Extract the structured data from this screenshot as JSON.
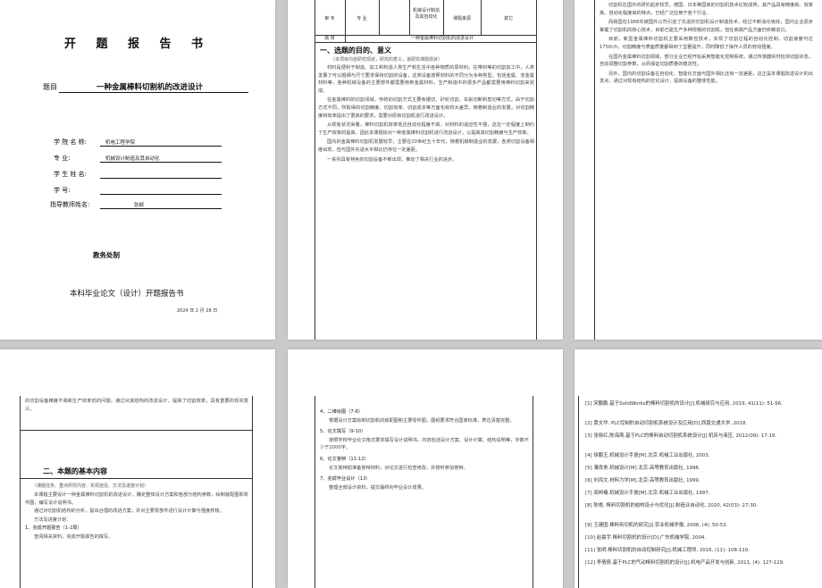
{
  "cover": {
    "title": "开 题 报 告 书",
    "topic_label": "题目",
    "topic_value": "一种金属棒料切割机的改进设计",
    "fields": [
      {
        "label": "学 院 名 称:",
        "value": "机电工程学院"
      },
      {
        "label": "专       业:",
        "value": "机械设计制造及其自动化"
      },
      {
        "label": "学 生 姓 名:",
        "value": ""
      },
      {
        "label": "学       号:",
        "value": ""
      },
      {
        "label": "指导教师姓名:",
        "value": "张颖"
      }
    ],
    "office": "教务处制",
    "report_name": "本科毕业论文（设计）开题报告书",
    "date": "2024 年 2 月 28 日"
  },
  "page2": {
    "table_row": [
      "审 专",
      "专 业",
      "机械设计制造及其自动化",
      "课题来源",
      "其它"
    ],
    "topic_row_label": "题  目",
    "topic_row_value": "一种金属棒料切割机的改进设计",
    "section1": "一、选题的目的、意义",
    "section1_note": "（本项目内容研究现状，研究的意义，该研究课题现状）",
    "paragraphs": [
      "材料是便利于制造、加工和构造人类生产和生活中各种物质的原材料。在带材等的切割加工中，人类发展了可以粗细与尺寸要求保持切割的设备，这类设备按照材料的不同分为多种类型，包括金属、非金属材料等，各种机械设备的主要部件都需要用到金属材料，生产制造中的很多产品都需要用棒料切割来完成。",
      "在金属棒料的切割领域，传统的切割方式主要有锯切、砂轮切割、车削切断和剪切等方式，由于切割方式不同，所取得的切割精度、切割效率、切割成本等方面也有较大差异。随着制造业的发展，对切割精度和效率提出了更高的要求，需要对原有切割机进行改进设计。",
      "从现有状况来看，棒料切割机效率低且自动化程度不高，对材料的适应性不强，这在一定程度上制约了生产效率的提高。因此本课题拟对一种金属棒料切割机进行改进设计，以提高其切割精度与生产效率。",
      "国内的金属棒料切割机发展较早，主要在20世纪五十年代，随着机械制造业的发展，各类切割设备相继出现，但与国外先进水平相比仍存在一定差距。",
      "一系列具有特色的切割设备不断出现，推动了相关行业的进步。"
    ]
  },
  "page3": {
    "paragraphs": [
      "切割机在国外的研究起步较早，德国、日本等国家的切割机技术比较成熟，其产品具有精度高、效率高、自动化程度高的特点，已经广泛应用于各个行业。",
      "而我国在1988年被国外公司引进了先进的切割机设计制造技术，经过不断消化吸收，国内企业逐步掌握了切割机的核心技术，目前已能生产多种规格的切割机，但在高端产品方面仍依赖进口。",
      "目前，新型金属棒料切割机主要采用数控技术，实现了切割过程的自动化控制，切割速度可达1750r/h，切割精度与表面质量都得到了显著提升，同时降低了操作人员的劳动强度。",
      "在国内金属棒料切割领域，部分企业已经开始采用智能化控制系统，通过传感器实时检测切割状态，自动调整切割参数，从而保证切割质量的稳定性。",
      "另外，国内的切割设备在自动化、智能化方面与国外相比还有一定差距，这正是本课题改进设计的出发点，通过对现有结构的优化设计，提高设备的整体性能。"
    ]
  },
  "page4": {
    "intro": "的切割设备精度不高和生产效率低的问题，通过对其结构的改进设计，提高了切割效率，具有重要的现实意义。",
    "section2": "二、本题的基本内容",
    "section2_note": "（课题任务、重点研究内容、实现途径、方法及进度计划）",
    "paragraphs": [
      "本课题主要设计一种金属棒料切割机的改进设计，确定整体设计方案和各部分结构参数，绘制装配图和零件图，编写设计说明书。",
      "通过对切割机结构的分析，提出合理的改进方案，并对主要零部件进行设计计算与强度校核。",
      "方法及进度计划："
    ],
    "step1": "1、完成开题报告（1-2周）",
    "step1_text": "查阅相关资料，完成开题报告的撰写。"
  },
  "page5": {
    "steps": [
      {
        "title": "4、二维绘图（7-8）",
        "text": "根据设计方案绘制切割机的装配图和主要零件图，图纸要求符合国家标准，表达清楚完整。"
      },
      {
        "title": "5、论文撰写（9-10）",
        "text": "按照学校毕业论文格式要求撰写设计说明书，内容包括设计方案、设计计算、结构说明等，字数不少于2000字。"
      },
      {
        "title": "6、论文答辩（11-12）",
        "text": "论文答辩前准备答辩材料，对论文进行检查修改，并按时参加答辩。"
      },
      {
        "title": "7、完成毕业设计（13）",
        "text": "整理全部设计资料，提交最终的毕业设计成果。"
      }
    ]
  },
  "page6": {
    "references": [
      "[1] 宋鹏鹏.基于SolidWorks的棒料切割机的设计[J].机械研究与应用, 2019, 41(11): 51-56.",
      "[2] 黄文华. PLC控制的自动切割机系统设计及应用[D].西南交通大学, 2018.",
      "[3] 张晓红,陈海燕.基于PLC的棒料自动切割机系统设计[J].机床与液压, 2012(09): 17-19.",
      "[4] 徐鹏玉.机械设计手册[M].北京:机械工业出版社, 2003.",
      "[5] 濮良贵.机械设计[M].北京:高等教育出版社, 1996.",
      "[6] 刘鸿文.材料力学[M].北京:高等教育出版社, 1999.",
      "[7] 闻邦椿.机械设计手册[M].北京:机械工业出版社, 1997.",
      "[8] 陈艳, 棒料切割机的结构设计与优化[J].制造业自动化, 2020, 42(03): 27-30.",
      "[9] 王建国.棒料剪切机的研究[J].农业机械学报, 2006, (4): 50-53.",
      "[10] 赵晨宇.棒料切割机的设计[D].广东机械学院, 2004.",
      "[11] 张明.棒料切割机的自动控制研究[J].机械工程师, 2016, (11): 108-110.",
      "[12] 李倩倩.基于PLC的气动棒料切割机的设计[J].机电产品开发与创新, 2011, (4): 127-129."
    ]
  }
}
